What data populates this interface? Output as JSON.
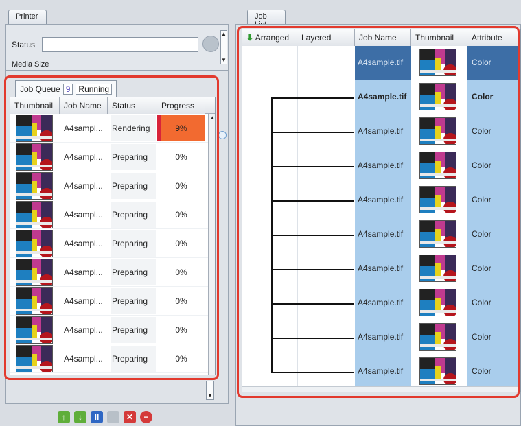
{
  "printer": {
    "tab_label": "Printer",
    "status_label": "Status",
    "status_value": "",
    "media_size_label": "Media Size"
  },
  "queue": {
    "tab_label": "Job Queue",
    "count": "9",
    "running_label": "Running",
    "columns": [
      "Thumbnail",
      "Job Name",
      "Status",
      "Progress"
    ],
    "rows": [
      {
        "name": "A4sampl...",
        "status": "Rendering",
        "progress": "9%",
        "progress_fraction": 0.09
      },
      {
        "name": "A4sampl...",
        "status": "Preparing",
        "progress": "0%"
      },
      {
        "name": "A4sampl...",
        "status": "Preparing",
        "progress": "0%"
      },
      {
        "name": "A4sampl...",
        "status": "Preparing",
        "progress": "0%"
      },
      {
        "name": "A4sampl...",
        "status": "Preparing",
        "progress": "0%"
      },
      {
        "name": "A4sampl...",
        "status": "Preparing",
        "progress": "0%"
      },
      {
        "name": "A4sampl...",
        "status": "Preparing",
        "progress": "0%"
      },
      {
        "name": "A4sampl...",
        "status": "Preparing",
        "progress": "0%"
      },
      {
        "name": "A4sampl...",
        "status": "Preparing",
        "progress": "0%"
      }
    ]
  },
  "joblist": {
    "tab_label": "Job List",
    "columns": [
      "Arranged",
      "Layered",
      "Job Name",
      "Thumbnail",
      "Attribute"
    ],
    "rows": [
      {
        "name": "A4sample.tif",
        "attribute": "Color",
        "selected": true
      },
      {
        "name": "A4sample.tif",
        "attribute": "Color",
        "bold": true
      },
      {
        "name": "A4sample.tif",
        "attribute": "Color"
      },
      {
        "name": "A4sample.tif",
        "attribute": "Color"
      },
      {
        "name": "A4sample.tif",
        "attribute": "Color"
      },
      {
        "name": "A4sample.tif",
        "attribute": "Color"
      },
      {
        "name": "A4sample.tif",
        "attribute": "Color"
      },
      {
        "name": "A4sample.tif",
        "attribute": "Color"
      },
      {
        "name": "A4sample.tif",
        "attribute": "Color"
      },
      {
        "name": "A4sample.tif",
        "attribute": "Color"
      }
    ]
  },
  "toolbar": {
    "buttons": [
      "move-up-icon",
      "move-down-icon",
      "pause-icon",
      "stop-icon",
      "delete-icon",
      "cancel-icon"
    ]
  },
  "colors": {
    "accent_blue": "#a9cdec",
    "selected_row": "#3d6ea6",
    "progress_orange": "#f26a30",
    "highlight_red": "#e23a2e"
  }
}
